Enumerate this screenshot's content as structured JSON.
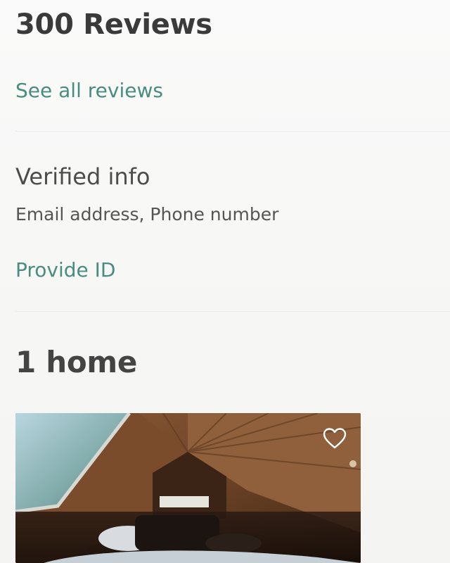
{
  "reviews": {
    "title": "300 Reviews",
    "see_all_label": "See all reviews"
  },
  "verified": {
    "title": "Verified info",
    "details": "Email address, Phone number",
    "provide_id_label": "Provide ID"
  },
  "homes": {
    "title": "1 home"
  },
  "icons": {
    "favorite": "heart-icon"
  },
  "colors": {
    "link": "#4a8c80",
    "heading": "#3a3a3a"
  }
}
